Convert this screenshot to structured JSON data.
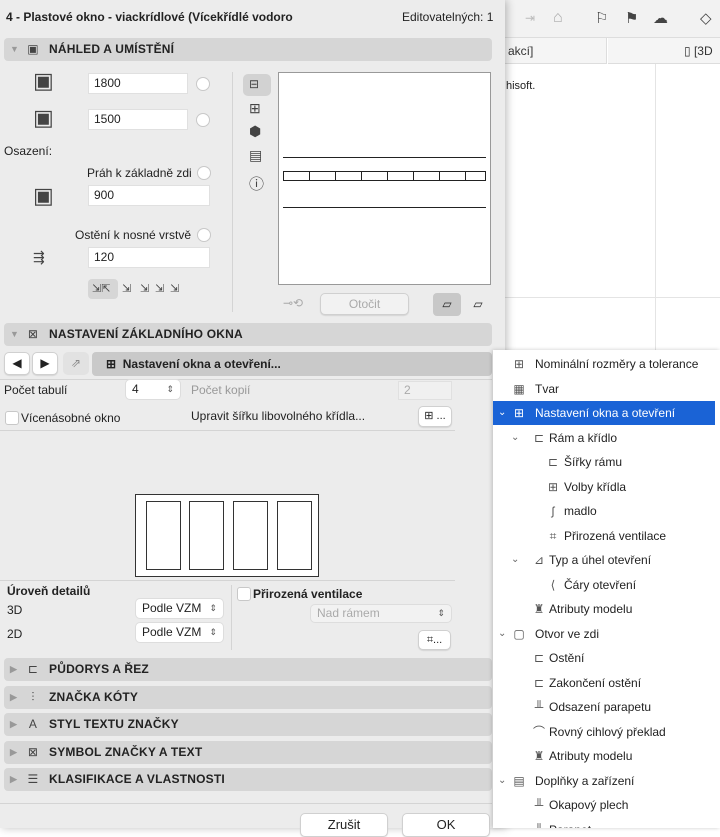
{
  "app": {
    "tab_left": "akcí]",
    "tab_right": "[3D",
    "text_fragment": "hisoft."
  },
  "dialog": {
    "title": "4 - Plastové okno - viackrídlové (Vícekřídlé vodoro",
    "editable": "Editovatelných: 1"
  },
  "sections": {
    "preview": {
      "label": "NÁHLED A UMÍSTĚNÍ",
      "width": "1800",
      "height": "1500",
      "osazeni": "Osazení:",
      "prah_label": "Práh k základně zdi",
      "prah_value": "900",
      "osteni_label": "Ostění k nosné vrstvě",
      "osteni_value": "120",
      "rotate": "Otočit"
    },
    "basic": {
      "label": "NASTAVENÍ ZÁKLADNÍHO OKNA",
      "page": "Nastavení okna a otevření...",
      "pocet_tabuli_label": "Počet tabulí",
      "pocet_tabuli": "4",
      "pocet_kopii_label": "Počet kopií",
      "pocet_kopii": "2",
      "multi_label": "Vícenásobné okno",
      "edit_width": "Upravit šířku libovolného křídla...",
      "detail_label": "Úroveň detailů",
      "d3_label": "3D",
      "d3_value": "Podle VZM",
      "d2_label": "2D",
      "d2_value": "Podle VZM",
      "vent_label": "Přirozená ventilace",
      "vent_value": "Nad rámem",
      "ellipsis": "..."
    },
    "collapsed": [
      "PŮDORYS A ŘEZ",
      "ZNAČKA KÓTY",
      "STYL TEXTU ZNAČKY",
      "SYMBOL ZNAČKY A TEXT",
      "KLASIFIKACE A VLASTNOSTI"
    ]
  },
  "buttons": {
    "cancel": "Zrušit",
    "ok": "OK"
  },
  "tree": [
    {
      "label": "Nominální rozměry a tolerance",
      "level": 0,
      "icon": "⊞"
    },
    {
      "label": "Tvar",
      "level": 0,
      "icon": "▦"
    },
    {
      "label": "Nastavení okna a otevření",
      "level": 0,
      "icon": "⊞",
      "expanded": true,
      "selected": true
    },
    {
      "label": "Rám a křídlo",
      "level": 1,
      "icon": "⊏",
      "expanded": true
    },
    {
      "label": "Šířky rámu",
      "level": 2,
      "icon": "⊏"
    },
    {
      "label": "Volby křídla",
      "level": 2,
      "icon": "⊞"
    },
    {
      "label": "madlo",
      "level": 2,
      "icon": "ʃ"
    },
    {
      "label": "Přirozená ventilace",
      "level": 2,
      "icon": "⌗"
    },
    {
      "label": "Typ a úhel otevření",
      "level": 1,
      "icon": "⊿",
      "expanded": true
    },
    {
      "label": "Čáry otevření",
      "level": 2,
      "icon": "⟨"
    },
    {
      "label": "Atributy modelu",
      "level": 1,
      "icon": "♜"
    },
    {
      "label": "Otvor ve zdi",
      "level": 0,
      "icon": "▢",
      "expanded": true
    },
    {
      "label": "Ostění",
      "level": 1,
      "icon": "⊏"
    },
    {
      "label": "Zakončení ostění",
      "level": 1,
      "icon": "⊏"
    },
    {
      "label": "Odsazení parapetu",
      "level": 1,
      "icon": "╨"
    },
    {
      "label": "Rovný cihlový překlad",
      "level": 1,
      "icon": "⌒"
    },
    {
      "label": "Atributy modelu",
      "level": 1,
      "icon": "♜"
    },
    {
      "label": "Doplňky a zařízení",
      "level": 0,
      "icon": "▤",
      "expanded": true
    },
    {
      "label": "Okapový plech",
      "level": 1,
      "icon": "╨"
    },
    {
      "label": "Parapet",
      "level": 1,
      "icon": "╨"
    }
  ]
}
